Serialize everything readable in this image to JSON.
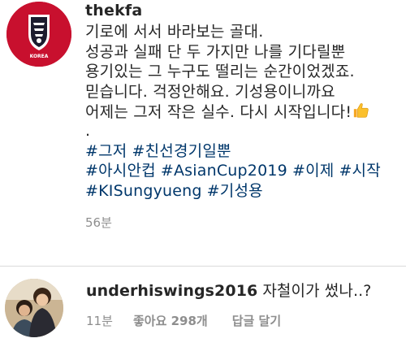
{
  "post": {
    "username": "thekfa",
    "caption_lines": [
      "기로에 서서 바라보는 골대.",
      "성공과 실패 단 두 가지만 나를 기다릴뿐",
      "용기있는 그 누구도 떨리는 순간이었겠죠.",
      "믿습니다. 걱정안해요. 기성용이니까요",
      "어제는 그저 작은 실수. 다시 시작입니다!"
    ],
    "dot": ".",
    "emoji": "thumbs-up-icon",
    "hashtags": [
      [
        "#그저",
        "#친선경기일뿐"
      ],
      [
        "#아시안컵",
        "#AsianCup2019",
        "#이제",
        "#시작"
      ],
      [
        "#KISungyueng",
        "#기성용"
      ]
    ],
    "time": "56분"
  },
  "comment": {
    "username": "underhiswings2016",
    "text": "자철이가 썼나..?",
    "time": "11분",
    "likes": "좋아요 298개",
    "reply": "답글 달기"
  },
  "colors": {
    "text": "#262626",
    "muted": "#8e8e8e",
    "hashtag": "#00376b",
    "kfa_red": "#c8102e",
    "divider": "#dbdbdb"
  }
}
